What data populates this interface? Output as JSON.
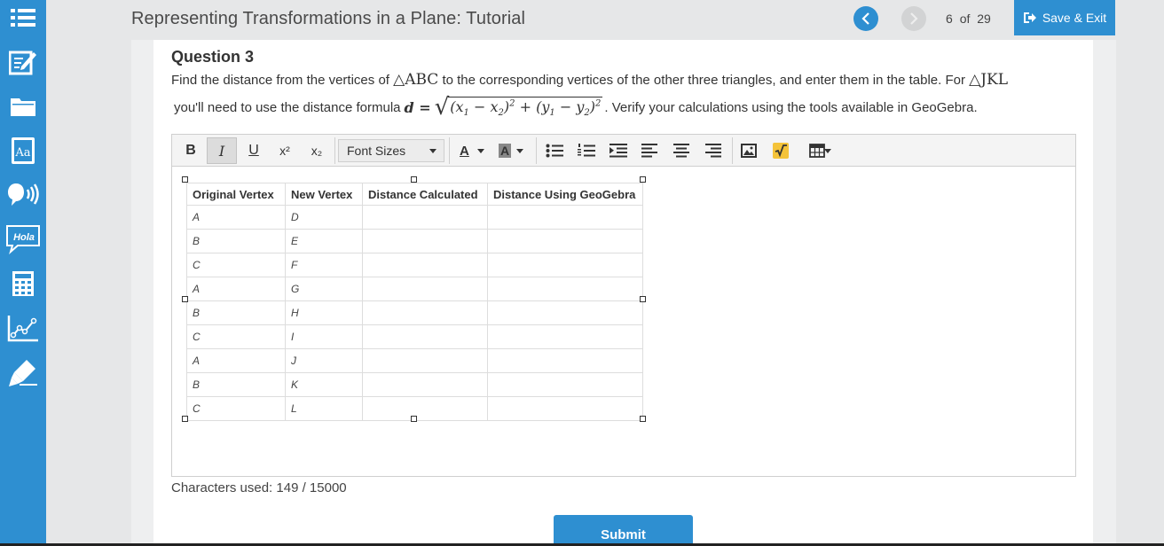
{
  "header": {
    "title": "Representing Transformations in a Plane: Tutorial",
    "page_current": "6",
    "page_of": "of",
    "page_total": "29",
    "save_exit_label": "Save & Exit"
  },
  "sidebar": {
    "items": [
      {
        "icon": "list-icon"
      },
      {
        "icon": "edit-icon"
      },
      {
        "icon": "folder-icon"
      },
      {
        "icon": "dictionary-icon",
        "label": "Aa"
      },
      {
        "icon": "speaker-icon"
      },
      {
        "icon": "translate-icon",
        "label": "Hola"
      },
      {
        "icon": "calculator-icon"
      },
      {
        "icon": "graph-icon"
      },
      {
        "icon": "highlighter-icon"
      }
    ]
  },
  "question": {
    "title": "Question 3",
    "line1_a": "Find the distance from the vertices of ",
    "tri_abc": "△ABC",
    "line1_b": " to the corresponding vertices of the other three triangles, and enter them in the table. For ",
    "tri_jkl": "△JKL",
    "line2_a": "you'll need to use the distance formula ",
    "formula_lhs": "d =",
    "line2_b": ". Verify your calculations using the tools available in GeoGebra."
  },
  "editor": {
    "toolbar": {
      "bold": "B",
      "italic": "I",
      "underline": "U",
      "superscript": "x²",
      "subscript": "x₂",
      "font_sizes": "Font Sizes",
      "font_color": "A",
      "bg_color": "A"
    },
    "table": {
      "headers": [
        "Original Vertex",
        "New Vertex",
        "Distance Calculated",
        "Distance Using GeoGebra"
      ],
      "rows": [
        [
          "A",
          "D",
          "",
          ""
        ],
        [
          "B",
          "E",
          "",
          ""
        ],
        [
          "C",
          "F",
          "",
          ""
        ],
        [
          "A",
          "G",
          "",
          ""
        ],
        [
          "B",
          "H",
          "",
          ""
        ],
        [
          "C",
          "I",
          "",
          ""
        ],
        [
          "A",
          "J",
          "",
          ""
        ],
        [
          "B",
          "K",
          "",
          ""
        ],
        [
          "C",
          "L",
          "",
          ""
        ]
      ]
    }
  },
  "footer": {
    "chars_used": "Characters used: 149 / 15000",
    "submit_label": "Submit"
  },
  "colors": {
    "accent": "#2e8fd1",
    "background": "#e6e7e8"
  }
}
